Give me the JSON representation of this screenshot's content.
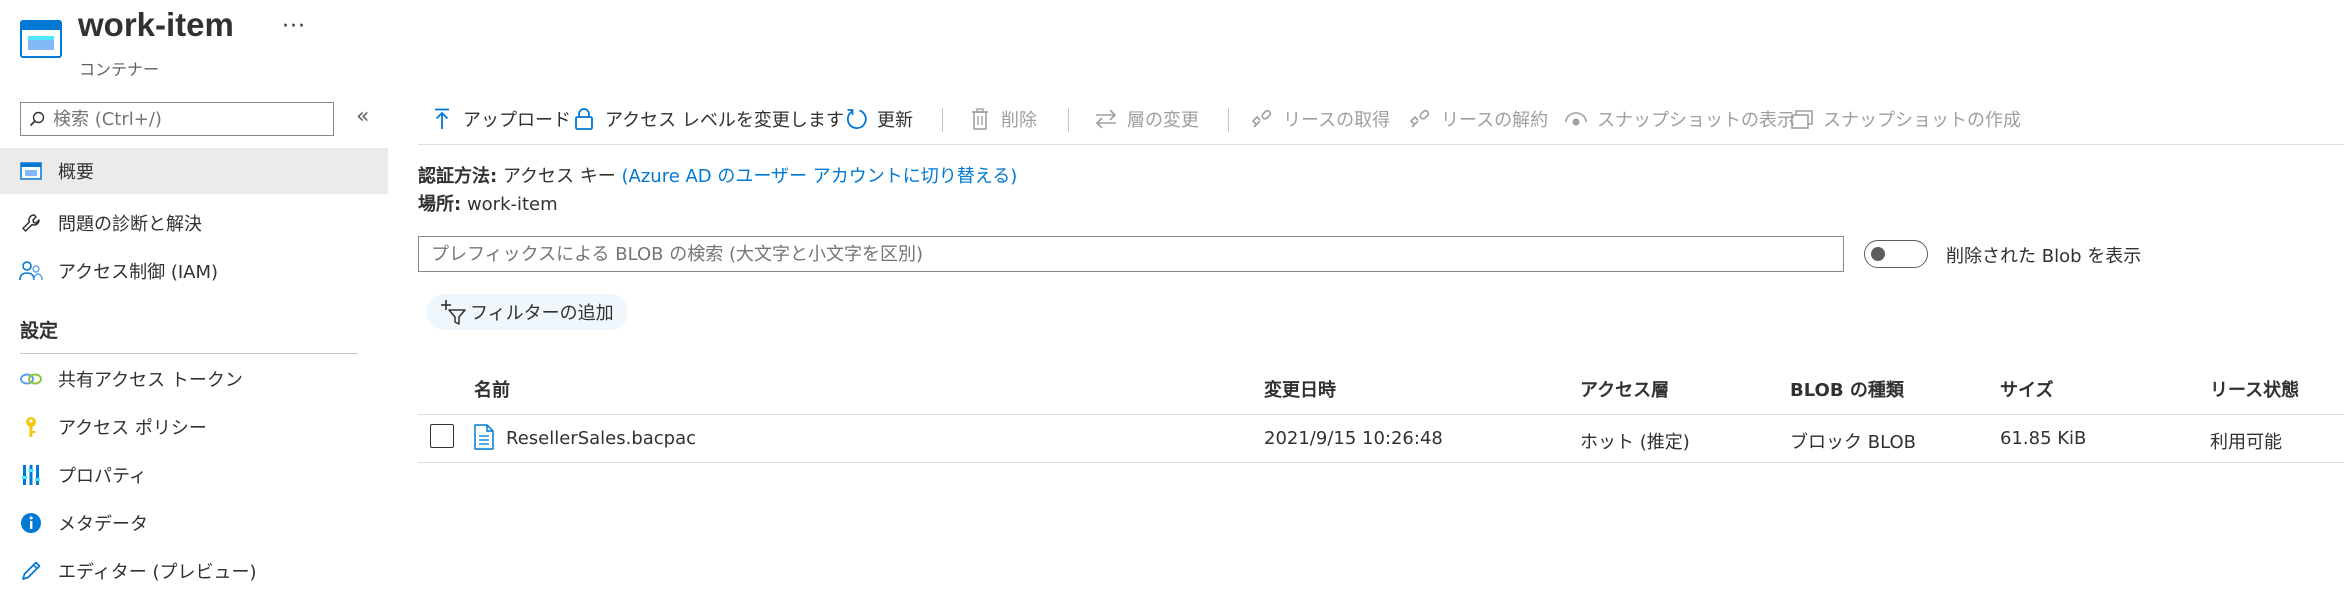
{
  "header": {
    "title": "work-item",
    "subtitle": "コンテナー",
    "more": "···"
  },
  "sidebar": {
    "search_placeholder": "検索 (Ctrl+/)",
    "collapse": "«",
    "items": [
      {
        "label": "概要",
        "icon": "container-icon",
        "active": true
      },
      {
        "label": "問題の診断と解決",
        "icon": "wrench-icon"
      },
      {
        "label": "アクセス制御 (IAM)",
        "icon": "people-icon"
      }
    ],
    "section_settings": "設定",
    "settings_items": [
      {
        "label": "共有アクセス トークン",
        "icon": "link-icon"
      },
      {
        "label": "アクセス ポリシー",
        "icon": "key-icon"
      },
      {
        "label": "プロパティ",
        "icon": "properties-icon"
      },
      {
        "label": "メタデータ",
        "icon": "info-icon"
      },
      {
        "label": "エディター (プレビュー)",
        "icon": "pencil-icon"
      }
    ]
  },
  "toolbar": {
    "upload": "アップロード",
    "change_access": "アクセス レベルを変更します",
    "refresh": "更新",
    "delete": "削除",
    "change_tier": "層の変更",
    "acquire_lease": "リースの取得",
    "break_lease": "リースの解約",
    "view_snapshots": "スナップショットの表示",
    "create_snapshot": "スナップショットの作成"
  },
  "info": {
    "auth_label": "認証方法:",
    "auth_value": "アクセス キー",
    "auth_link": "(Azure AD のユーザー アカウントに切り替える)",
    "location_label": "場所:",
    "location_value": "work-item"
  },
  "blob_search": {
    "placeholder": "プレフィックスによる BLOB の検索 (大文字と小文字を区別)"
  },
  "show_deleted": {
    "label": "削除された Blob を表示",
    "on": false
  },
  "filter": {
    "label": "フィルターの追加"
  },
  "table": {
    "columns": [
      "名前",
      "変更日時",
      "アクセス層",
      "BLOB の種類",
      "サイズ",
      "リース状態"
    ],
    "rows": [
      {
        "name": "ResellerSales.bacpac",
        "modified": "2021/9/15 10:26:48",
        "tier": "ホット (推定)",
        "type": "ブロック BLOB",
        "size": "61.85 KiB",
        "lease": "利用可能"
      }
    ]
  },
  "colors": {
    "accent": "#0078d4",
    "active_bg": "#edebe9",
    "disabled": "#a19f9d"
  }
}
